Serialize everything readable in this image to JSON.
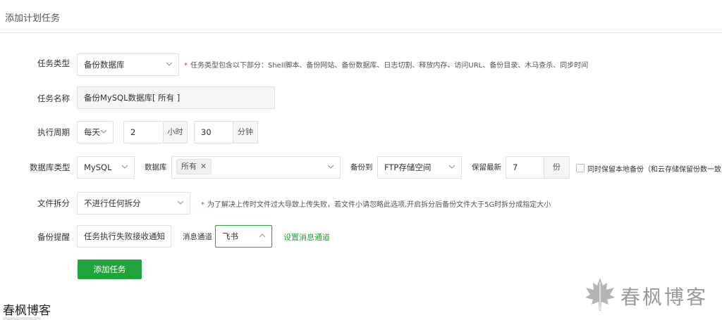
{
  "page": {
    "title": "添加计划任务"
  },
  "form": {
    "task_type": {
      "label": "任务类型",
      "value": "备份数据库",
      "hint": "任务类型包含以下部分：Shell脚本、备份网站、备份数据库、日志切割、释放内存、访问URL、备份目录、木马查杀、同步时间"
    },
    "task_name": {
      "label": "任务名称",
      "value": "备份MySQL数据库[ 所有 ]"
    },
    "period": {
      "label": "执行周期",
      "frequency": "每天",
      "hour_value": "2",
      "hour_unit": "小时",
      "minute_value": "30",
      "minute_unit": "分钟"
    },
    "database": {
      "type_label": "数据库类型",
      "type_value": "MySQL",
      "db_label": "数据库",
      "db_tag": "所有",
      "backup_to_label": "备份到",
      "backup_to_value": "FTP存储空间",
      "keep_label": "保留最新",
      "keep_value": "7",
      "keep_unit": "份",
      "keep_local_label": "同时保留本地备份（和云存储保留份数一致）",
      "keep_local_checked": false
    },
    "split": {
      "label": "文件拆分",
      "value": "不进行任何拆分",
      "hint": "为了解决上传时文件过大导致上传失败，若文件小请忽略此选项,开启拆分后备份文件大于5G时拆分成指定大小"
    },
    "notify": {
      "label": "备份提醒",
      "value": "任务执行失败接收通知",
      "channel_label": "消息通道",
      "channel_value": "飞书",
      "setup_link": "设置消息通道"
    },
    "submit_label": "添加任务"
  },
  "watermark": {
    "left_text": "春枫博客",
    "right_text": "春枫博客",
    "right_logo": "maple-leaf-icon"
  },
  "colors": {
    "accent": "#20a53a",
    "required": "#e53935",
    "border": "#dcdfe6"
  }
}
